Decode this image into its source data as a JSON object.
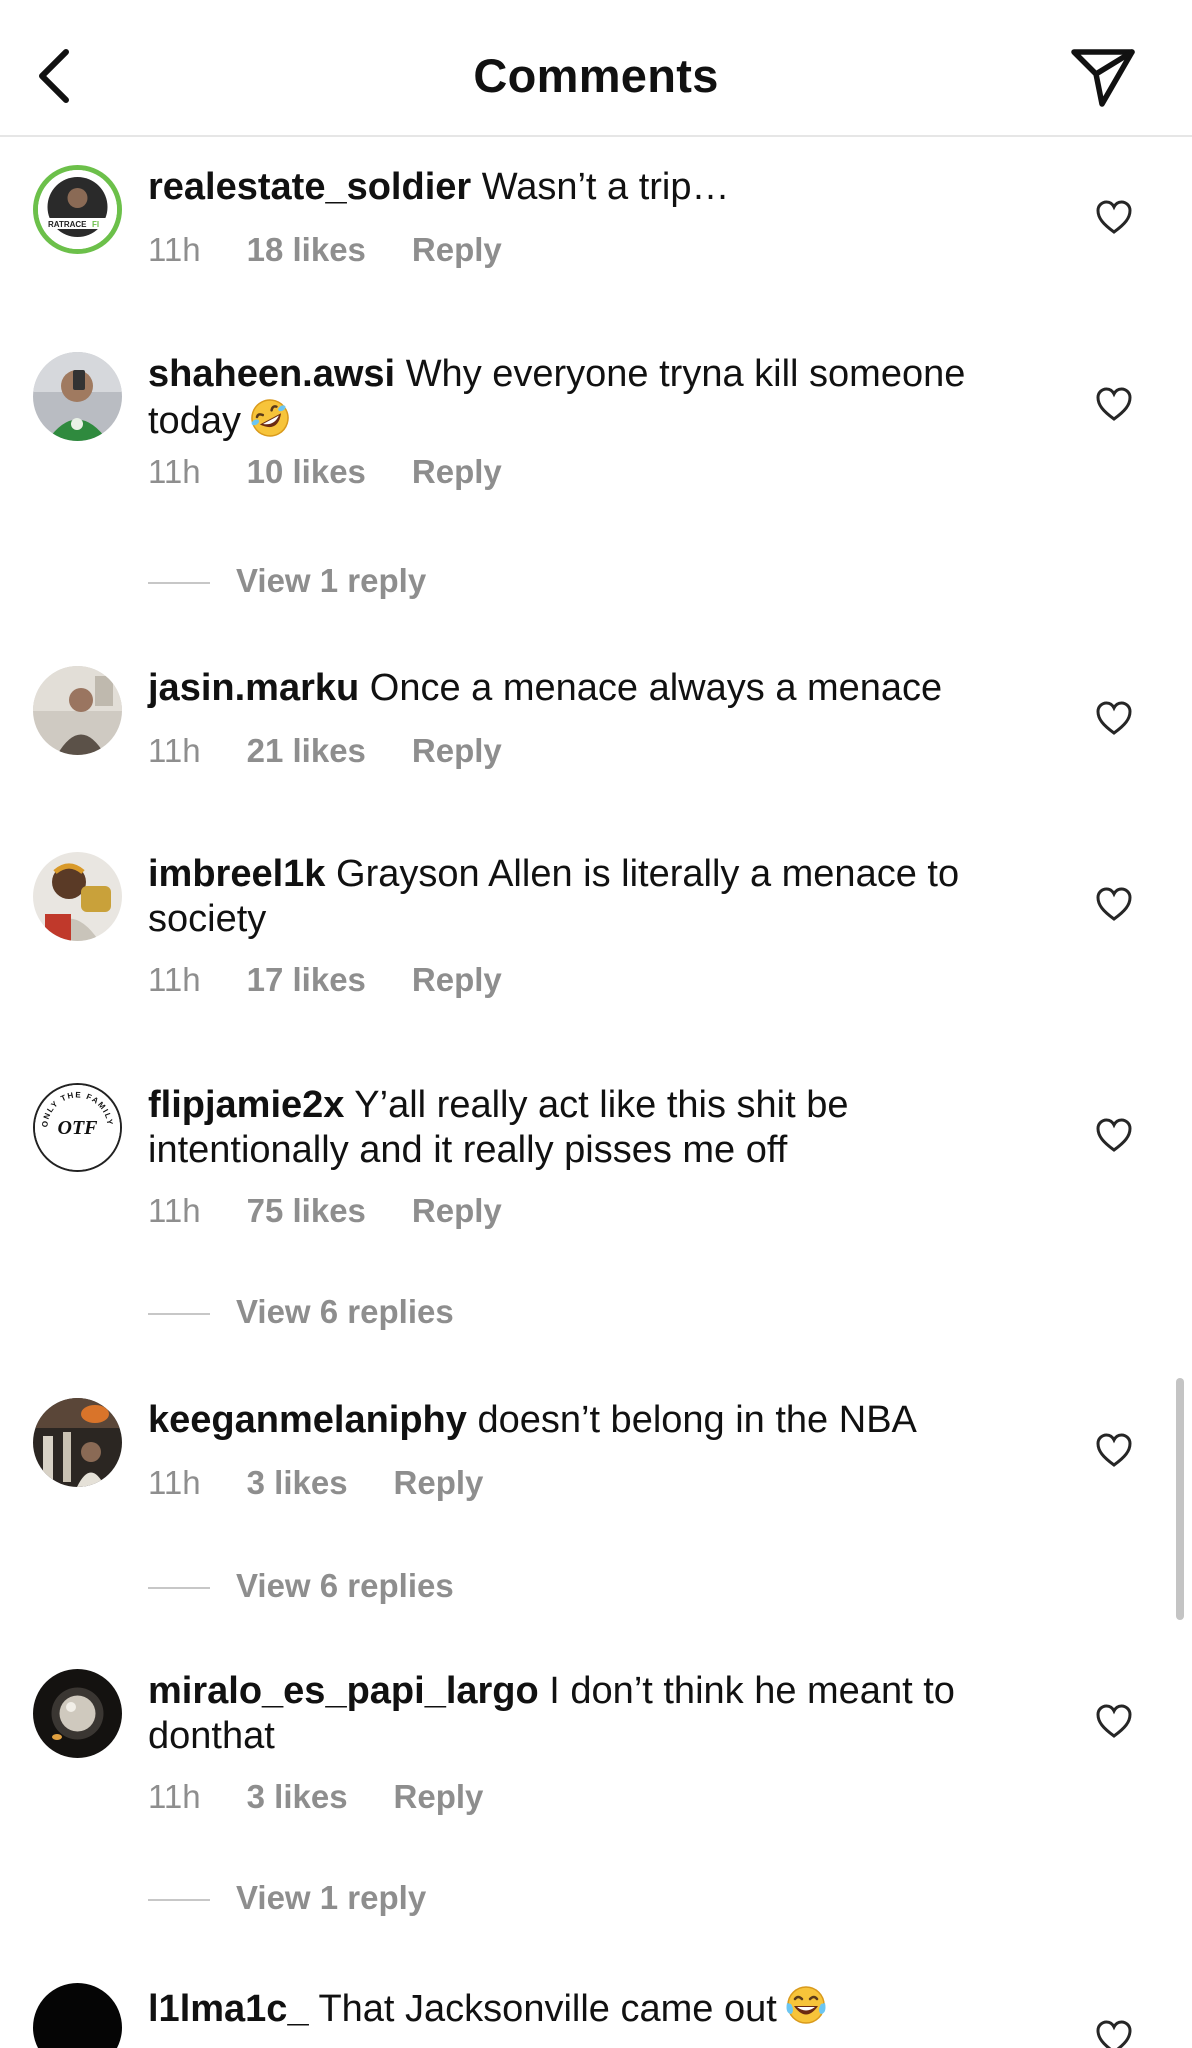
{
  "header": {
    "title": "Comments",
    "back_icon": "chevron-left-icon",
    "share_icon": "paper-plane-icon"
  },
  "comments": [
    {
      "username": "realestate_soldier",
      "text": "Wasn’t a trip…",
      "time": "11h",
      "likes": "18 likes",
      "reply": "Reply"
    },
    {
      "username": "shaheen.awsi",
      "text": "Why everyone tryna kill someone today",
      "emoji": "rolling-on-floor-laughing-emoji",
      "time": "11h",
      "likes": "10 likes",
      "reply": "Reply",
      "view_replies": "View 1 reply"
    },
    {
      "username": "jasin.marku",
      "text": "Once a menace always a menace",
      "time": "11h",
      "likes": "21 likes",
      "reply": "Reply"
    },
    {
      "username": "imbreel1k",
      "text": "Grayson Allen is literally a menace to society",
      "time": "11h",
      "likes": "17 likes",
      "reply": "Reply"
    },
    {
      "username": "flipjamie2x",
      "text": "Y’all really act like this shit be intentionally and it really pisses me off",
      "time": "11h",
      "likes": "75 likes",
      "reply": "Reply",
      "view_replies": "View 6 replies"
    },
    {
      "username": "keeganmelaniphy",
      "text": "doesn’t belong in the NBA",
      "time": "11h",
      "likes": "3 likes",
      "reply": "Reply",
      "view_replies": "View 6 replies"
    },
    {
      "username": "miralo_es_papi_largo",
      "text": "I don’t think he meant to donthat",
      "time": "11h",
      "likes": "3 likes",
      "reply": "Reply",
      "view_replies": "View 1 reply"
    },
    {
      "username": "l1lma1c_",
      "text": "That Jacksonville came out",
      "emoji": "tears-of-joy-emoji"
    }
  ],
  "avatars": {
    "realestate_soldier": {
      "badge_text": "RATRACE",
      "badge_suffix": "FI"
    },
    "flipjamie2x": {
      "logo_text": "OTF",
      "ring_text": "ONLY THE FAMILY"
    }
  },
  "colors": {
    "meta_gray": "#8e8e8e",
    "text": "#111111",
    "divider": "#e6e6e6",
    "avatar_ring": "#6cc04a"
  }
}
